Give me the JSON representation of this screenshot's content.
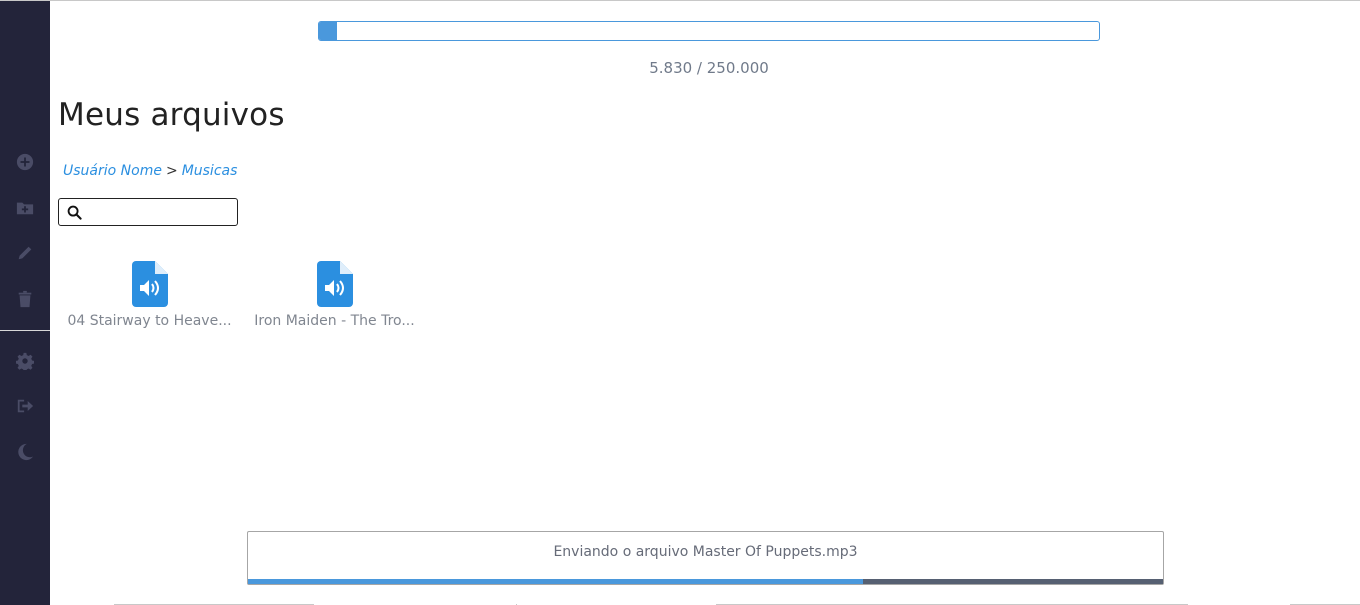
{
  "colors": {
    "sidebar_bg": "#23243a",
    "sidebar_icon": "#4a4c66",
    "accent": "#4a98dc",
    "link": "#2b8fe0",
    "upload_track": "#566072"
  },
  "sidebar": {
    "items": [
      {
        "name": "add-circle-icon"
      },
      {
        "name": "folder-plus-icon"
      },
      {
        "name": "pencil-icon"
      },
      {
        "name": "trash-icon"
      },
      {
        "name": "gear-icon"
      },
      {
        "name": "sign-out-icon"
      },
      {
        "name": "moon-icon"
      }
    ]
  },
  "quota": {
    "used": "5.830",
    "total": "250.000",
    "text": "5.830 / 250.000",
    "fraction": 0.0233
  },
  "page": {
    "title": "Meus arquivos"
  },
  "breadcrumb": {
    "items": [
      "Usuário Nome",
      "Musicas"
    ],
    "separator": ">"
  },
  "search": {
    "value": "",
    "icon": "search-icon"
  },
  "files": [
    {
      "name": "04 Stairway to Heave...",
      "icon": "audio-file-icon"
    },
    {
      "name": "Iron Maiden - The Tro...",
      "icon": "audio-file-icon"
    }
  ],
  "upload": {
    "text": "Enviando o arquivo Master Of Puppets.mp3",
    "progress": 0.672
  }
}
